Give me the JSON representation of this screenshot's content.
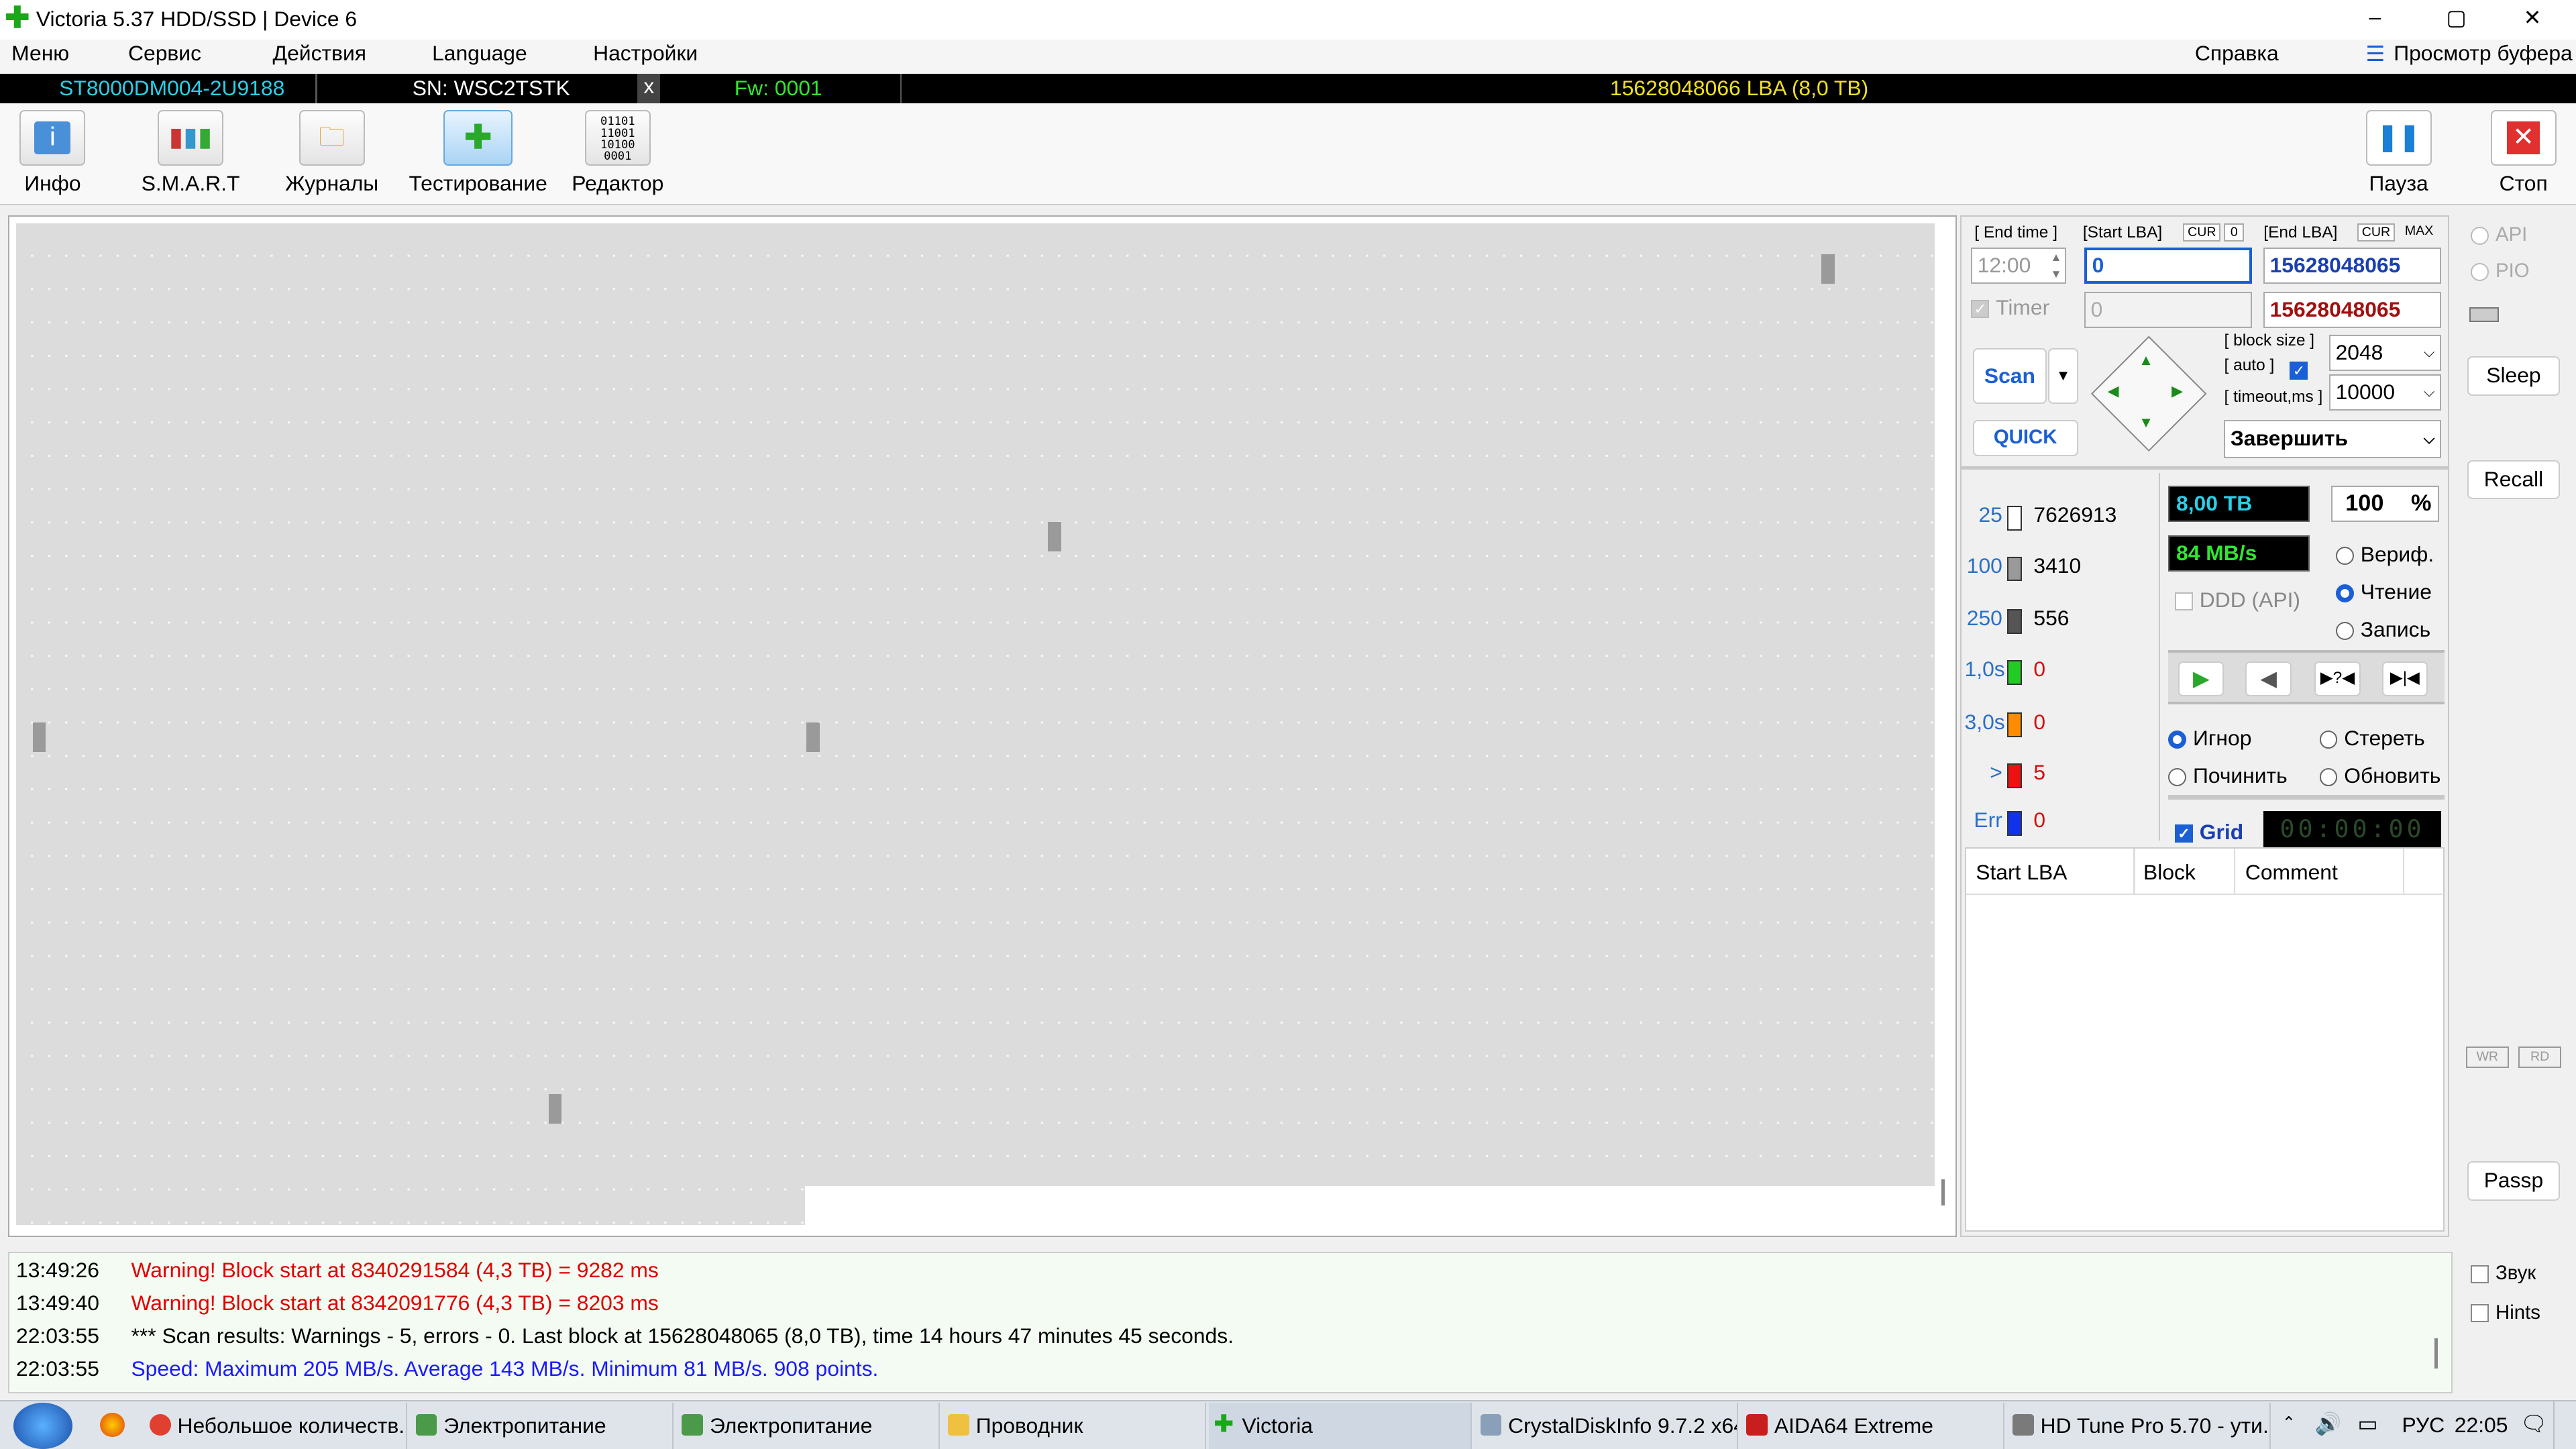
{
  "window": {
    "title": "Victoria 5.37 HDD/SSD | Device 6",
    "controls": {
      "minimize": "–",
      "maximize": "▢",
      "close": "✕"
    }
  },
  "menu": {
    "items": [
      "Меню",
      "Сервис",
      "Действия",
      "Language",
      "Настройки"
    ],
    "help": "Справка",
    "buffer": "Просмотр буфера"
  },
  "device": {
    "model": "ST8000DM004-2U9188",
    "serial": "SN: WSC2TSTK",
    "close": "x",
    "firmware": "Fw: 0001",
    "capacity": "15628048066 LBA (8,0 TB)"
  },
  "toolbar": {
    "info": "Инфо",
    "smart": "S.M.A.R.T",
    "logs": "Журналы",
    "test": "Тестирование",
    "editor": "Редактор",
    "pause": "Пауза",
    "stop": "Стоп"
  },
  "scan": {
    "end_time_label": "[ End time ]",
    "end_time": "12:00",
    "timer_label": "Timer",
    "start_lba_label": "[Start LBA]",
    "cur": "CUR",
    "zero": "0",
    "start_lba": "0",
    "start_lba2": "0",
    "end_lba_label": "[End LBA]",
    "max": "MAX",
    "end_lba": "15628048065",
    "end_lba2": "15628048065",
    "scan_btn": "Scan",
    "quick_btn": "QUICK",
    "block_size_label": "[ block size ]",
    "auto_label": "[ auto ]",
    "block_size": "2048",
    "timeout_label": "[ timeout,ms ]",
    "timeout": "10000",
    "finish": "Завершить"
  },
  "histogram": [
    {
      "label": "25",
      "count": "7626913",
      "color": "#ffffff"
    },
    {
      "label": "100",
      "count": "3410",
      "color": "#9a9a9a"
    },
    {
      "label": "250",
      "count": "556",
      "color": "#555555"
    },
    {
      "label": "1,0s",
      "count": "0",
      "color": "#22cc22"
    },
    {
      "label": "3,0s",
      "count": "0",
      "color": "#ff8c00"
    },
    {
      "label": ">",
      "count": "5",
      "color": "#ee1111"
    },
    {
      "label": "Err",
      "count": "0",
      "color": "#1133ee"
    }
  ],
  "stats": {
    "size": "8,00 TB",
    "percent": "100",
    "pct_sign": "%",
    "speed": "84 MB/s",
    "ddd": "DDD (API)",
    "verify": "Вериф.",
    "read": "Чтение",
    "write": "Запись",
    "ignore": "Игнор",
    "erase": "Стереть",
    "repair": "Починить",
    "refresh": "Обновить",
    "grid": "Grid",
    "timer": "00:00:00"
  },
  "table": {
    "headers": [
      "Start LBA",
      "Block",
      "Comment"
    ]
  },
  "side": {
    "api": "API",
    "pio": "PIO",
    "sleep": "Sleep",
    "recall": "Recall",
    "passp": "Passp",
    "sound": "Звук",
    "hints": "Hints",
    "wr": "WR",
    "rd": "RD"
  },
  "log": [
    {
      "time": "13:49:26",
      "msg": "Warning! Block start at 8340291584 (4,3 TB)  = 9282 ms",
      "color": "#e00000"
    },
    {
      "time": "13:49:40",
      "msg": "Warning! Block start at 8342091776 (4,3 TB)  = 8203 ms",
      "color": "#e00000"
    },
    {
      "time": "22:03:55",
      "msg": "*** Scan results: Warnings - 5, errors - 0. Last block at 15628048065 (8,0 TB), time 14 hours 47 minutes 45 seconds.",
      "color": "#000000"
    },
    {
      "time": "22:03:55",
      "msg": "Speed: Maximum 205 MB/s. Average 143 MB/s. Minimum 81 MB/s. 908 points.",
      "color": "#1a1aff"
    }
  ],
  "taskbar": {
    "tasks": [
      "Небольшое количеств...",
      "Электропитание",
      "Электропитание",
      "Проводник",
      "Victoria",
      "CrystalDiskInfo 9.7.2 x64",
      "AIDA64 Extreme",
      "HD Tune Pro 5.70 - ути..."
    ],
    "lang": "РУС",
    "clock": "22:05"
  },
  "colors": {
    "accent": "#1a5fd6",
    "warning": "#e00000",
    "speed": "#1a1aff"
  }
}
